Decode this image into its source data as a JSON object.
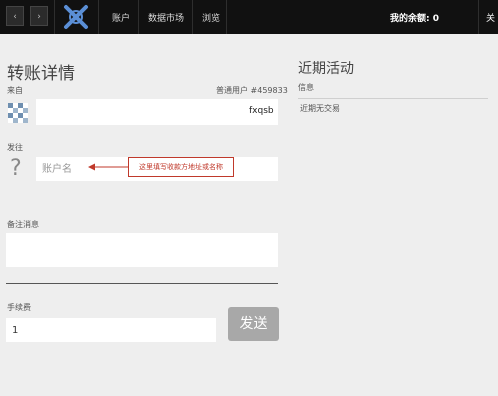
{
  "topbar": {
    "back_icon": "‹",
    "forward_icon": "›",
    "logo": "x-logo",
    "menu": [
      "账户",
      "数据市场",
      "浏览"
    ],
    "balance": "我的余额: 0",
    "corner_text": "关"
  },
  "transfer": {
    "title": "转账详情",
    "from_label": "来自",
    "account_type": "普通用户 #459833",
    "from_name": "fxqsb",
    "to_label": "发往",
    "to_placeholder": "账户名",
    "memo_label": "备注消息",
    "fee_label": "手续费",
    "fee_value": "1",
    "send_label": "发送",
    "annotation": "这里填写收款方地址或名称"
  },
  "activity": {
    "title": "近期活动",
    "column_header": "信息",
    "empty_text": "近期无交易"
  },
  "colors": {
    "topbar": "#111111",
    "background": "#eeeeee",
    "logo": "#5b8fd6",
    "annotation": "#c0392b",
    "send_button": "#a8a8a8"
  }
}
